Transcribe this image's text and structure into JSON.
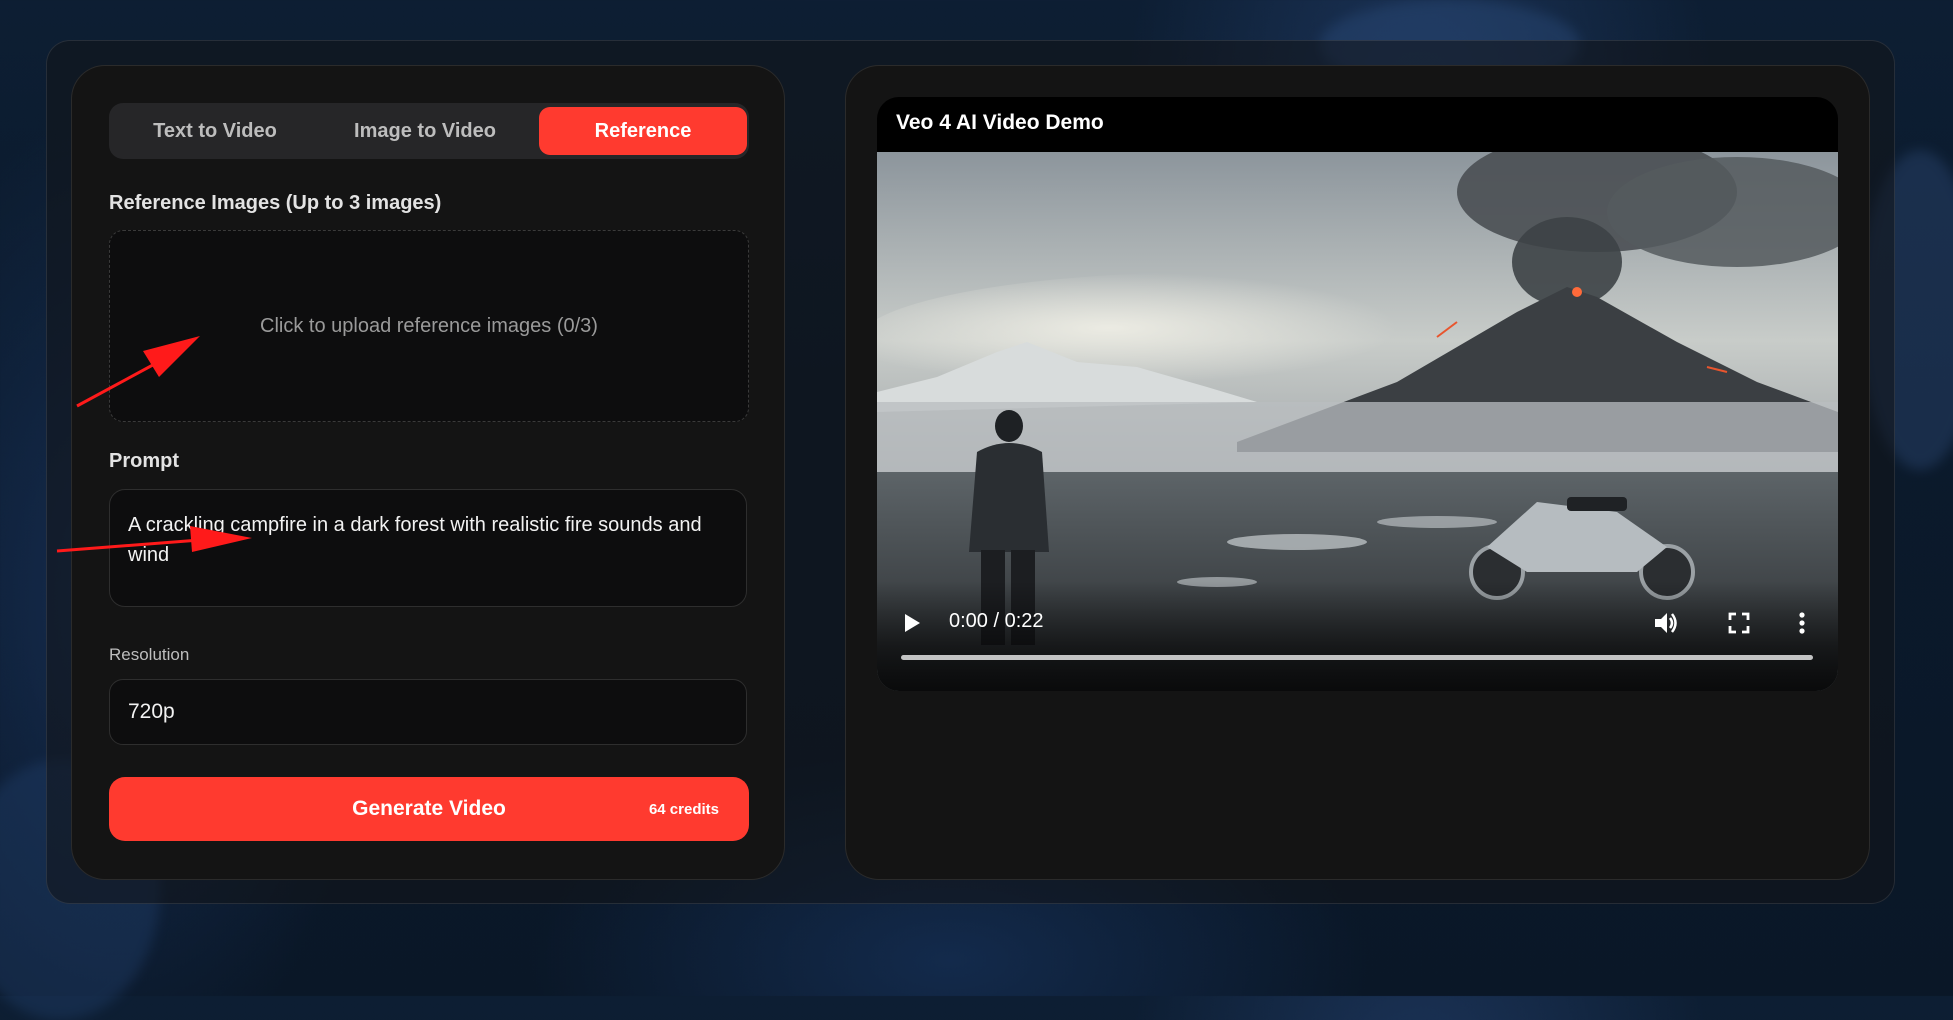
{
  "tabs": [
    {
      "label": "Text to Video",
      "active": false
    },
    {
      "label": "Image to Video",
      "active": false
    },
    {
      "label": "Reference",
      "active": true
    }
  ],
  "reference": {
    "label": "Reference Images (Up to 3 images)",
    "upload_text": "Click to upload reference images (0/3)"
  },
  "prompt": {
    "label": "Prompt",
    "value": "A crackling campfire in a dark forest with realistic fire sounds and wind"
  },
  "resolution": {
    "label": "Resolution",
    "value": "720p"
  },
  "generate": {
    "label": "Generate Video",
    "credits": "64 credits"
  },
  "video": {
    "title": "Veo 4 AI Video Demo",
    "time": "0:00 / 0:22",
    "progress": 0
  },
  "colors": {
    "accent": "#ff3a2f",
    "panel": "#141414",
    "field": "#0d0d0e"
  },
  "icons": [
    "play-icon",
    "volume-icon",
    "fullscreen-icon",
    "more-options-icon",
    "annotation-arrow-icon"
  ]
}
